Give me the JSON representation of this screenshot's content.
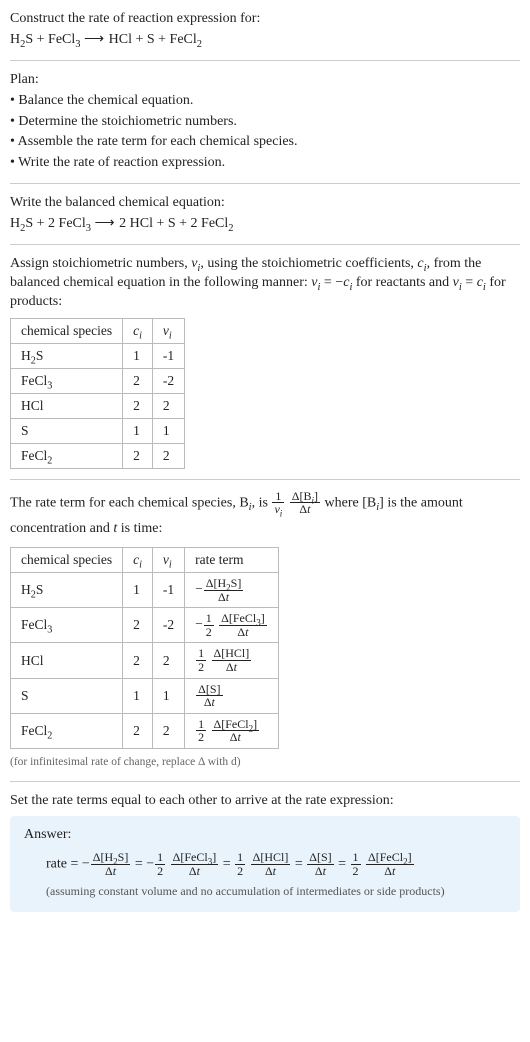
{
  "intro": {
    "line": "Construct the rate of reaction expression for:"
  },
  "plan": {
    "heading": "Plan:",
    "items": [
      "• Balance the chemical equation.",
      "• Determine the stoichiometric numbers.",
      "• Assemble the rate term for each chemical species.",
      "• Write the rate of reaction expression."
    ]
  },
  "balanced_heading": "Write the balanced chemical equation:",
  "assign_heading_a": "Assign stoichiometric numbers, ",
  "assign_heading_b": ", using the stoichiometric coefficients, ",
  "assign_heading_c": ", from the balanced chemical equation in the following manner: ",
  "assign_heading_d": " for reactants and ",
  "assign_heading_e": " for products:",
  "table1": {
    "headers": [
      "chemical species",
      "cᵢ",
      "νᵢ"
    ],
    "rows": [
      {
        "sp": "H2S",
        "c": "1",
        "v": "-1"
      },
      {
        "sp": "FeCl3",
        "c": "2",
        "v": "-2"
      },
      {
        "sp": "HCl",
        "c": "2",
        "v": "2"
      },
      {
        "sp": "S",
        "c": "1",
        "v": "1"
      },
      {
        "sp": "FeCl2",
        "c": "2",
        "v": "2"
      }
    ]
  },
  "rateterm_a": "The rate term for each chemical species, ",
  "rateterm_b": ", is ",
  "rateterm_c": " where ",
  "rateterm_d": " is the amount concentration and ",
  "rateterm_e": " is time:",
  "table2": {
    "headers": [
      "chemical species",
      "cᵢ",
      "νᵢ",
      "rate term"
    ]
  },
  "note_inf": "(for infinitesimal rate of change, replace Δ with d)",
  "set_equal": "Set the rate terms equal to each other to arrive at the rate expression:",
  "answer": {
    "label": "Answer:",
    "assume": "(assuming constant volume and no accumulation of intermediates or side products)"
  },
  "chart_data": {
    "type": "table",
    "title": "Stoichiometric numbers and rate terms for H2S + 2 FeCl3 → 2 HCl + S + 2 FeCl2",
    "unbalanced_equation": "H2S + FeCl3 → HCl + S + FeCl2",
    "balanced_equation": "H2S + 2 FeCl3 → 2 HCl + S + 2 FeCl2",
    "species": [
      {
        "name": "H2S",
        "c_i": 1,
        "nu_i": -1,
        "rate_term": "-Δ[H2S]/Δt"
      },
      {
        "name": "FeCl3",
        "c_i": 2,
        "nu_i": -2,
        "rate_term": "-(1/2) Δ[FeCl3]/Δt"
      },
      {
        "name": "HCl",
        "c_i": 2,
        "nu_i": 2,
        "rate_term": "(1/2) Δ[HCl]/Δt"
      },
      {
        "name": "S",
        "c_i": 1,
        "nu_i": 1,
        "rate_term": "Δ[S]/Δt"
      },
      {
        "name": "FeCl2",
        "c_i": 2,
        "nu_i": 2,
        "rate_term": "(1/2) Δ[FeCl2]/Δt"
      }
    ],
    "rate_expression": "rate = -Δ[H2S]/Δt = -(1/2) Δ[FeCl3]/Δt = (1/2) Δ[HCl]/Δt = Δ[S]/Δt = (1/2) Δ[FeCl2]/Δt"
  }
}
